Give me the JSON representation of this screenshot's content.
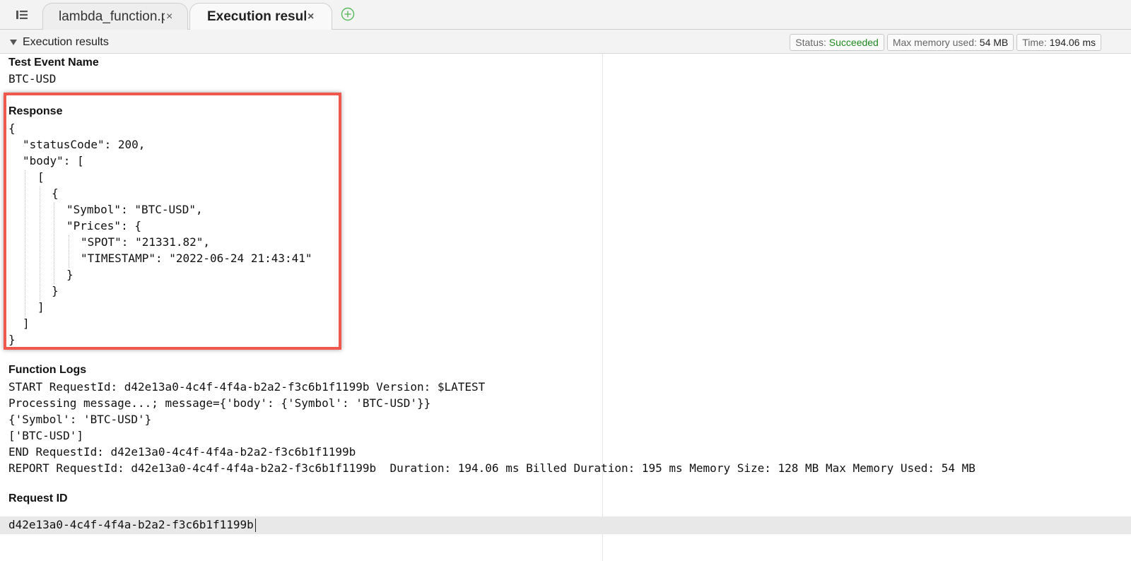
{
  "tabs": [
    {
      "label": "lambda_function.py",
      "close": "×"
    },
    {
      "label": "Execution results",
      "close": "×"
    }
  ],
  "section": {
    "title": "Execution results"
  },
  "status": {
    "status_label": "Status:",
    "status_value": "Succeeded",
    "memory_label": "Max memory used:",
    "memory_value": "54 MB",
    "time_label": "Time:",
    "time_value": "194.06 ms",
    "success_color": "#1d8a1d"
  },
  "test_event": {
    "heading": "Test Event Name",
    "value": "BTC-USD"
  },
  "response": {
    "heading": "Response",
    "lines": [
      "{",
      "\"statusCode\": 200,",
      "\"body\": [",
      "[",
      "{",
      "\"Symbol\": \"BTC-USD\",",
      "\"Prices\": {",
      "\"SPOT\": \"21331.82\",",
      "\"TIMESTAMP\": \"2022-06-24 21:43:41\"",
      "}",
      "}",
      "]",
      "]",
      "}"
    ]
  },
  "logs": {
    "heading": "Function Logs",
    "lines": [
      "START RequestId: d42e13a0-4c4f-4f4a-b2a2-f3c6b1f1199b Version: $LATEST",
      "Processing message...; message={'body': {'Symbol': 'BTC-USD'}}",
      "{'Symbol': 'BTC-USD'}",
      "['BTC-USD']",
      "END RequestId: d42e13a0-4c4f-4f4a-b2a2-f3c6b1f1199b",
      "REPORT RequestId: d42e13a0-4c4f-4f4a-b2a2-f3c6b1f1199b  Duration: 194.06 ms Billed Duration: 195 ms Memory Size: 128 MB Max Memory Used: 54 MB"
    ]
  },
  "request_id": {
    "heading": "Request ID",
    "value": "d42e13a0-4c4f-4f4a-b2a2-f3c6b1f1199b"
  },
  "icons": {
    "menu": "menu-icon",
    "add_tab": "add-tab-icon",
    "collapse": "collapse-caret-icon"
  },
  "colors": {
    "highlight_border": "#f0574d",
    "add_icon": "#5cb85c"
  }
}
